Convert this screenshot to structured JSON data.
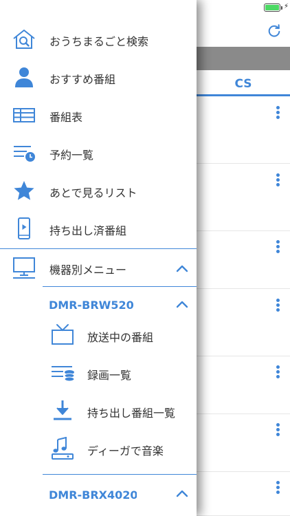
{
  "status": {
    "battery": "full",
    "charging": true
  },
  "background": {
    "tab_label": "CS",
    "row_count": 7
  },
  "menu": {
    "items": [
      {
        "label": "おうちまるごと検索",
        "icon": "home-search-icon"
      },
      {
        "label": "おすすめ番組",
        "icon": "person-icon"
      },
      {
        "label": "番組表",
        "icon": "table-icon"
      },
      {
        "label": "予約一覧",
        "icon": "schedule-list-icon"
      },
      {
        "label": "あとで見るリスト",
        "icon": "star-icon"
      },
      {
        "label": "持ち出し済番組",
        "icon": "phone-play-icon"
      }
    ],
    "device_menu": {
      "label": "機器別メニュー",
      "icon": "monitor-icon",
      "expanded": true
    },
    "devices": [
      {
        "name": "DMR-BRW520",
        "expanded": true,
        "items": [
          {
            "label": "放送中の番組",
            "icon": "tv-icon"
          },
          {
            "label": "録画一覧",
            "icon": "recording-list-icon"
          },
          {
            "label": "持ち出し番組一覧",
            "icon": "download-icon"
          },
          {
            "label": "ディーガで音楽",
            "icon": "music-icon"
          }
        ]
      },
      {
        "name": "DMR-BRX4020",
        "expanded": true
      }
    ]
  },
  "colors": {
    "accent": "#3f86d8",
    "shadow": "#8a8a8a"
  }
}
